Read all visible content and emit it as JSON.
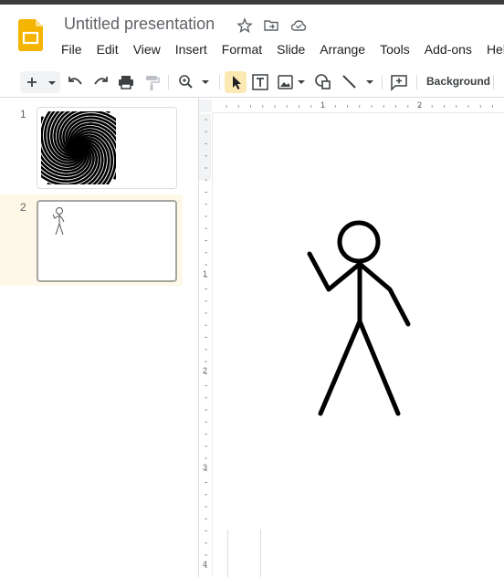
{
  "app": {
    "title": "Untitled presentation",
    "accent_color": "#fbbc04"
  },
  "menu": [
    "File",
    "Edit",
    "View",
    "Insert",
    "Format",
    "Slide",
    "Arrange",
    "Tools",
    "Add-ons",
    "Help"
  ],
  "toolbar": {
    "background_label": "Background",
    "icons": [
      "new-slide-icon",
      "undo-icon",
      "redo-icon",
      "print-icon",
      "paint-format-icon",
      "zoom-icon",
      "select-icon",
      "textbox-icon",
      "image-icon",
      "shape-icon",
      "line-icon",
      "comment-icon"
    ]
  },
  "slides": [
    {
      "number": "1",
      "content": "spiral-image"
    },
    {
      "number": "2",
      "content": "stick-figure",
      "selected": true
    }
  ],
  "ruler": {
    "horizontal": [
      "1",
      "2"
    ],
    "vertical": [
      "1",
      "2",
      "3",
      "4"
    ]
  }
}
